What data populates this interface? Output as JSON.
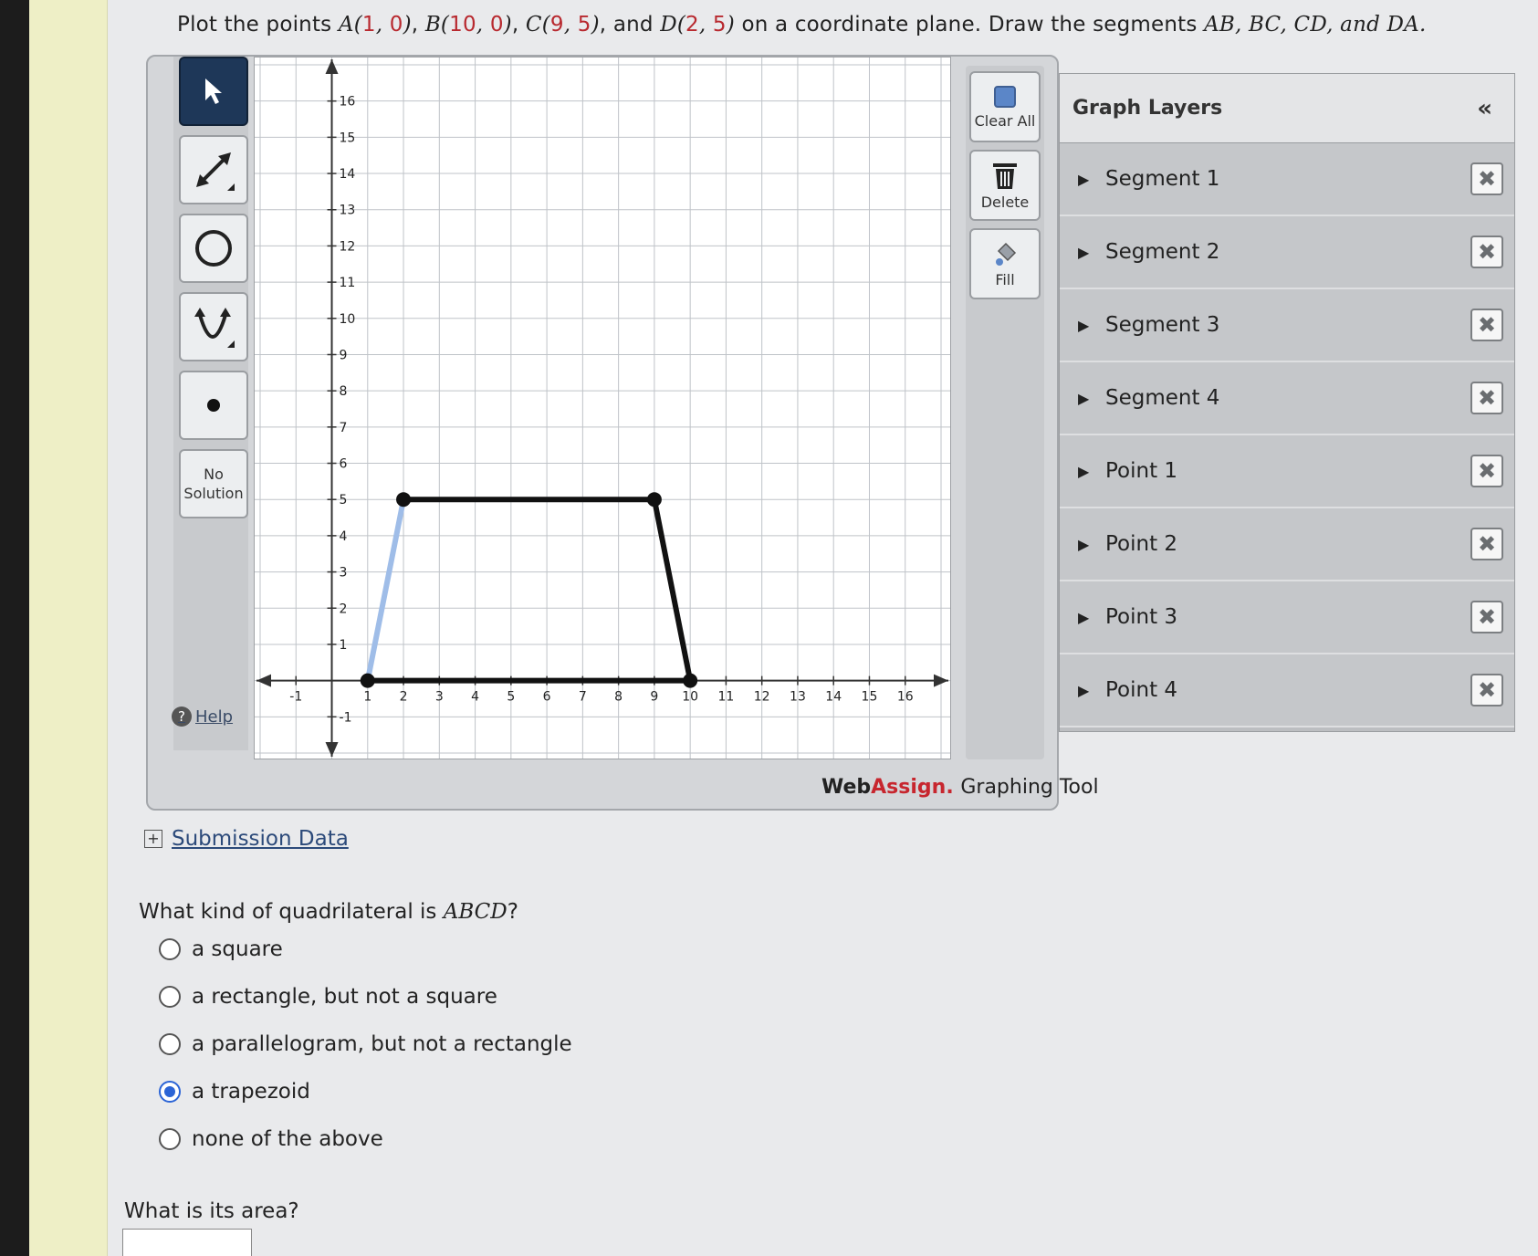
{
  "prompt": {
    "prefix": "Plot the points",
    "points": [
      {
        "label": "A",
        "x": "1",
        "y": "0"
      },
      {
        "label": "B",
        "x": "10",
        "y": "0"
      },
      {
        "label": "C",
        "x": "9",
        "y": "5"
      },
      {
        "label": "D",
        "x": "2",
        "y": "5"
      }
    ],
    "and": "and",
    "suffix": "on a coordinate plane. Draw the segments",
    "segments_text": "AB, BC, CD, and DA."
  },
  "toolbox": {
    "no_solution_line1": "No",
    "no_solution_line2": "Solution",
    "help": "Help"
  },
  "right_tools": {
    "clear_all": "Clear All",
    "delete": "Delete",
    "fill": "Fill"
  },
  "brand": {
    "web": "Web",
    "assign": "Assign.",
    "tool": "Graphing Tool"
  },
  "layers": {
    "title": "Graph Layers",
    "collapse": "«",
    "items": [
      {
        "name": "Segment 1"
      },
      {
        "name": "Segment 2"
      },
      {
        "name": "Segment 3"
      },
      {
        "name": "Segment 4"
      },
      {
        "name": "Point 1"
      },
      {
        "name": "Point 2"
      },
      {
        "name": "Point 3"
      },
      {
        "name": "Point 4"
      }
    ]
  },
  "submission": {
    "label": "Submission Data"
  },
  "question": {
    "prefix": "What kind of quadrilateral is",
    "shape": "ABCD",
    "mark": "?",
    "options": [
      {
        "label": "a square",
        "checked": false
      },
      {
        "label": "a rectangle, but not a square",
        "checked": false
      },
      {
        "label": "a parallelogram, but not a rectangle",
        "checked": false
      },
      {
        "label": "a trapezoid",
        "checked": true
      },
      {
        "label": "none of the above",
        "checked": false
      }
    ]
  },
  "area_question": "What is its area?",
  "graph": {
    "x_ticks": [
      "-1",
      "1",
      "2",
      "3",
      "4",
      "5",
      "6",
      "7",
      "8",
      "9",
      "10",
      "11",
      "12",
      "13",
      "14",
      "15",
      "16"
    ],
    "y_ticks": [
      "-1",
      "1",
      "2",
      "3",
      "4",
      "5",
      "6",
      "7",
      "8",
      "9",
      "10",
      "11",
      "12",
      "13",
      "14",
      "15",
      "16"
    ],
    "xlim": [
      -2,
      17
    ],
    "ylim": [
      -2,
      17
    ],
    "points": [
      {
        "x": 1,
        "y": 0,
        "color": "#111111"
      },
      {
        "x": 10,
        "y": 0,
        "color": "#111111"
      },
      {
        "x": 9,
        "y": 5,
        "color": "#111111"
      },
      {
        "x": 2,
        "y": 5,
        "color": "#111111"
      }
    ],
    "segments": [
      {
        "from": [
          1,
          0
        ],
        "to": [
          10,
          0
        ],
        "color": "#111111"
      },
      {
        "from": [
          10,
          0
        ],
        "to": [
          9,
          5
        ],
        "color": "#111111"
      },
      {
        "from": [
          9,
          5
        ],
        "to": [
          2,
          5
        ],
        "color": "#111111"
      },
      {
        "from": [
          2,
          5
        ],
        "to": [
          1,
          0
        ],
        "color": "#9fbde8"
      }
    ]
  }
}
